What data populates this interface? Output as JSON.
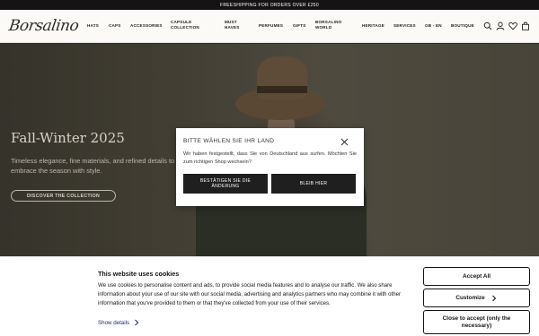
{
  "promo": {
    "text": "FREESHIPPING FOR ORDERS OVER £250"
  },
  "header": {
    "logo": "Borsalino",
    "nav": [
      {
        "label": "HATS"
      },
      {
        "label": "CAPS"
      },
      {
        "label": "ACCESSORIES"
      },
      {
        "label": "CAPSULE COLLECTION"
      },
      {
        "label": "MUST HAVES"
      },
      {
        "label": "PERFUMES"
      },
      {
        "label": "GIFTS"
      },
      {
        "label": "BORSALINO WORLD"
      },
      {
        "label": "HERITAGE"
      },
      {
        "label": "SERVICES"
      },
      {
        "label": "GB - EN"
      },
      {
        "label": "BOUTIQUE"
      }
    ],
    "icons": [
      "search-icon",
      "account-icon",
      "wishlist-icon",
      "cart-icon"
    ]
  },
  "hero": {
    "title": "Fall-Winter 2025",
    "subtitle": "Timeless elegance, fine materials, and refined details to embrace the season with style.",
    "cta": "DISCOVER THE COLLECTION"
  },
  "modal": {
    "title": "BITTE WÄHLEN SIE IHR LAND",
    "text": "Wir haben festgestellt, dass Sie von Deutschland aus surfen. Möchten Sie zum richtigen Shop wechseln?",
    "confirm_label": "BESTÄTIGEN SIE DIE ÄNDERUNG",
    "stay_label": "BLEIB HIER"
  },
  "cookie": {
    "title": "This website uses cookies",
    "text": "We use cookies to personalise content and ads, to provide social media features and to analyse our traffic. We also share information about your use of our site with our social media, advertising and analytics partners who may combine it with other information that you've provided to them or that they've collected from your use of their services.",
    "show_details": "Show details",
    "accept_all": "Accept All",
    "customize": "Customize",
    "close_accept": "Close to accept (only the necessary)"
  },
  "colors": {
    "dark": "#141414",
    "header_bg": "#fbfaf7",
    "link": "#1d2a6b"
  }
}
